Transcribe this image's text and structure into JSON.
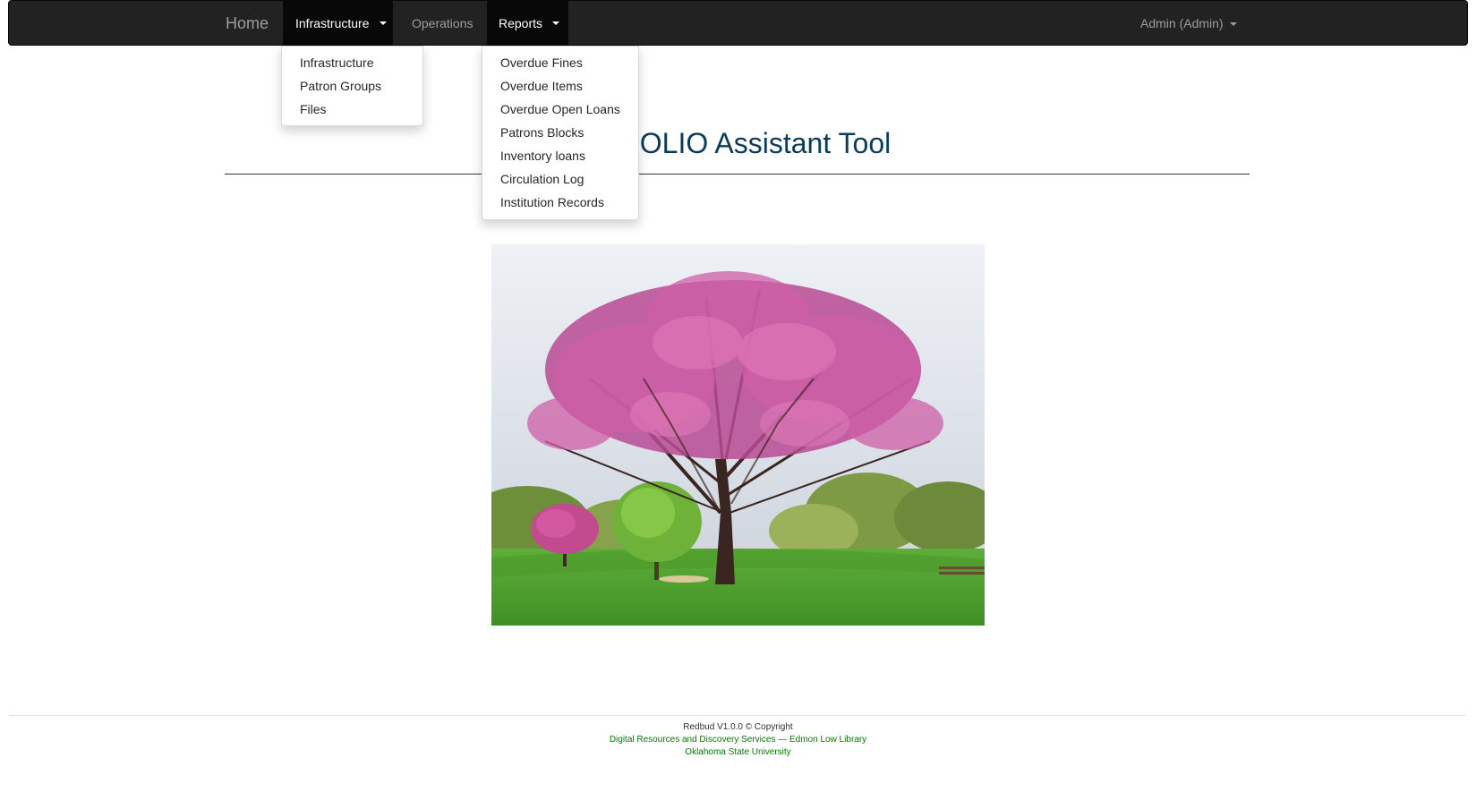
{
  "navbar": {
    "brand": "Home",
    "infrastructure_label": "Infrastructure",
    "operations_label": "Operations",
    "reports_label": "Reports",
    "user_label": "Admin (Admin)"
  },
  "infrastructure_menu": {
    "items": [
      "Infrastructure",
      "Patron Groups",
      "Files"
    ]
  },
  "reports_menu": {
    "items": [
      "Overdue Fines",
      "Overdue Items",
      "Overdue Open Loans",
      "Patrons Blocks",
      "Inventory loans",
      "Circulation Log",
      "Institution Records"
    ]
  },
  "main": {
    "title_visible": "d : FOLIO Assistant Tool",
    "hero_image": "redbud-tree"
  },
  "footer": {
    "line1": "Redbud V1.0.0 © Copyright",
    "line2": "Digital Resources and Discovery Services — Edmon Low Library",
    "line3": "Oklahoma State University"
  },
  "colors": {
    "navbar_bg": "#222222",
    "active_tab_bg": "#080808",
    "title": "#0b3c5d",
    "footer_link": "#008000"
  }
}
